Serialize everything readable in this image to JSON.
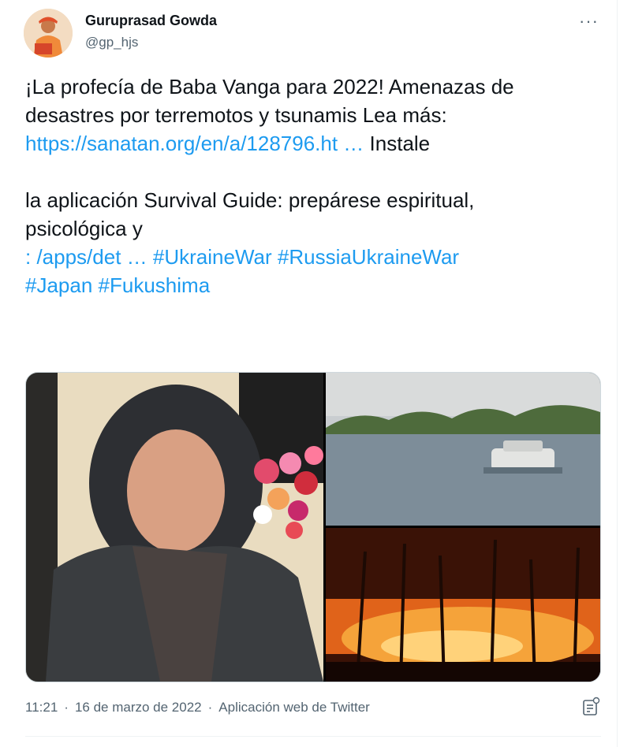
{
  "user": {
    "name": "Guruprasad Gowda",
    "handle": "@gp_hjs"
  },
  "tweet": {
    "line1": "¡La profecía de Baba Vanga para 2022! Amenazas de",
    "line2": "desastres por terremotos y tsunamis Lea más:",
    "link1": "https://sanatan.org/en/a/128796.ht …",
    "after_link1": " Instale",
    "line4": "la aplicación Survival Guide: prepárese espiritual,",
    "line5": "psicológica y",
    "link2": "  :  /apps/det …",
    "tags_line1": [
      "#UkraineWar",
      "#RussiaUkraineWar"
    ],
    "tags_line2": [
      "#Japan",
      "#Fukushima"
    ]
  },
  "meta": {
    "time": "11:21",
    "sep1": "·",
    "date": "16 de marzo de 2022",
    "sep2": "·",
    "source": "Aplicación web de Twitter"
  },
  "colors": {
    "link": "#1d9bf0",
    "secondary_text": "#536471",
    "text": "#0f1419"
  },
  "icons": {
    "more": "more-dots-icon",
    "analytics": "analytics-icon"
  }
}
